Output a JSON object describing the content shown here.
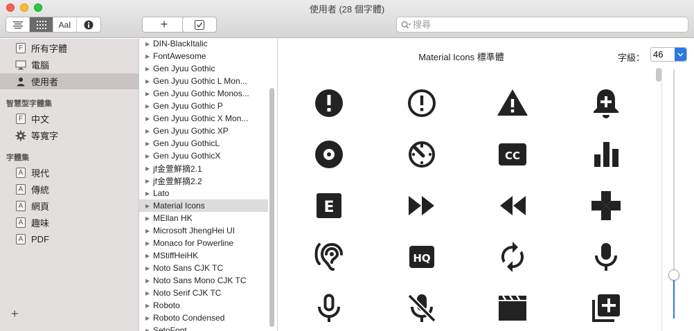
{
  "window": {
    "title": "使用者 (28 個字體)"
  },
  "toolbar": {
    "view_buttons": [
      {
        "icon": "list-lines-icon"
      },
      {
        "icon": "grid-icon"
      },
      {
        "label": "AaI"
      },
      {
        "icon": "info-icon"
      }
    ],
    "add_label": "+",
    "search": {
      "placeholder": "搜尋",
      "value": ""
    }
  },
  "sidebar": {
    "collections_top": [
      {
        "label": "所有字體",
        "icon": "font-box-icon",
        "glyph": "F"
      },
      {
        "label": "電腦",
        "icon": "monitor-icon"
      },
      {
        "label": "使用者",
        "icon": "person-icon",
        "selected": true
      }
    ],
    "smart_header": "智慧型字體集",
    "smart_items": [
      {
        "label": "中文",
        "icon": "font-box-icon",
        "glyph": "F"
      },
      {
        "label": "等寬字",
        "icon": "gear-icon"
      }
    ],
    "collections_header": "字體集",
    "collections": [
      {
        "label": "現代",
        "glyph": "A"
      },
      {
        "label": "傳統",
        "glyph": "A"
      },
      {
        "label": "網頁",
        "glyph": "A"
      },
      {
        "label": "趣味",
        "glyph": "A"
      },
      {
        "label": "PDF",
        "glyph": "A"
      }
    ],
    "add_label": "+"
  },
  "fontlist": {
    "items": [
      "DIN-BlackItalic",
      "FontAwesome",
      "Gen Jyuu Gothic",
      "Gen Jyuu Gothic L Mon...",
      "Gen Jyuu Gothic Monos...",
      "Gen Jyuu Gothic P",
      "Gen Jyuu Gothic X Mon...",
      "Gen Jyuu Gothic XP",
      "Gen Jyuu GothicL",
      "Gen Jyuu GothicX",
      "jf金萱鮮摘2.1",
      "jf金萱鮮摘2.2",
      "Lato",
      "Material Icons",
      "MEllan HK",
      "Microsoft JhengHei UI",
      "Monaco for Powerline",
      "MStiffHeiHK",
      "Noto Sans CJK TC",
      "Noto Sans Mono CJK TC",
      "Noto Serif CJK TC",
      "Roboto",
      "Roboto Condensed",
      "SetoFont"
    ],
    "selected": "Material Icons"
  },
  "preview": {
    "title": "Material Icons 標準體",
    "size_label": "字級：",
    "size_value": "46",
    "glyphs": [
      "error-icon",
      "error-outline-icon",
      "warning-icon",
      "add-alert-icon",
      "album-icon",
      "av-timer-icon",
      "closed-caption-icon",
      "equalizer-icon",
      "explicit-icon",
      "fast-forward-icon",
      "fast-rewind-icon",
      "games-icon",
      "hearing-icon",
      "hq-icon",
      "loop-icon",
      "mic-icon",
      "mic-none-icon",
      "mic-off-icon",
      "movie-icon",
      "library-add-icon"
    ]
  },
  "colors": {
    "accent": "#2a7ae2",
    "sidebar_bg": "#e4dfdf",
    "sidebar_selected": "#c9c3c3",
    "list_selected": "#dcdcdc",
    "glyph": "#222222"
  }
}
